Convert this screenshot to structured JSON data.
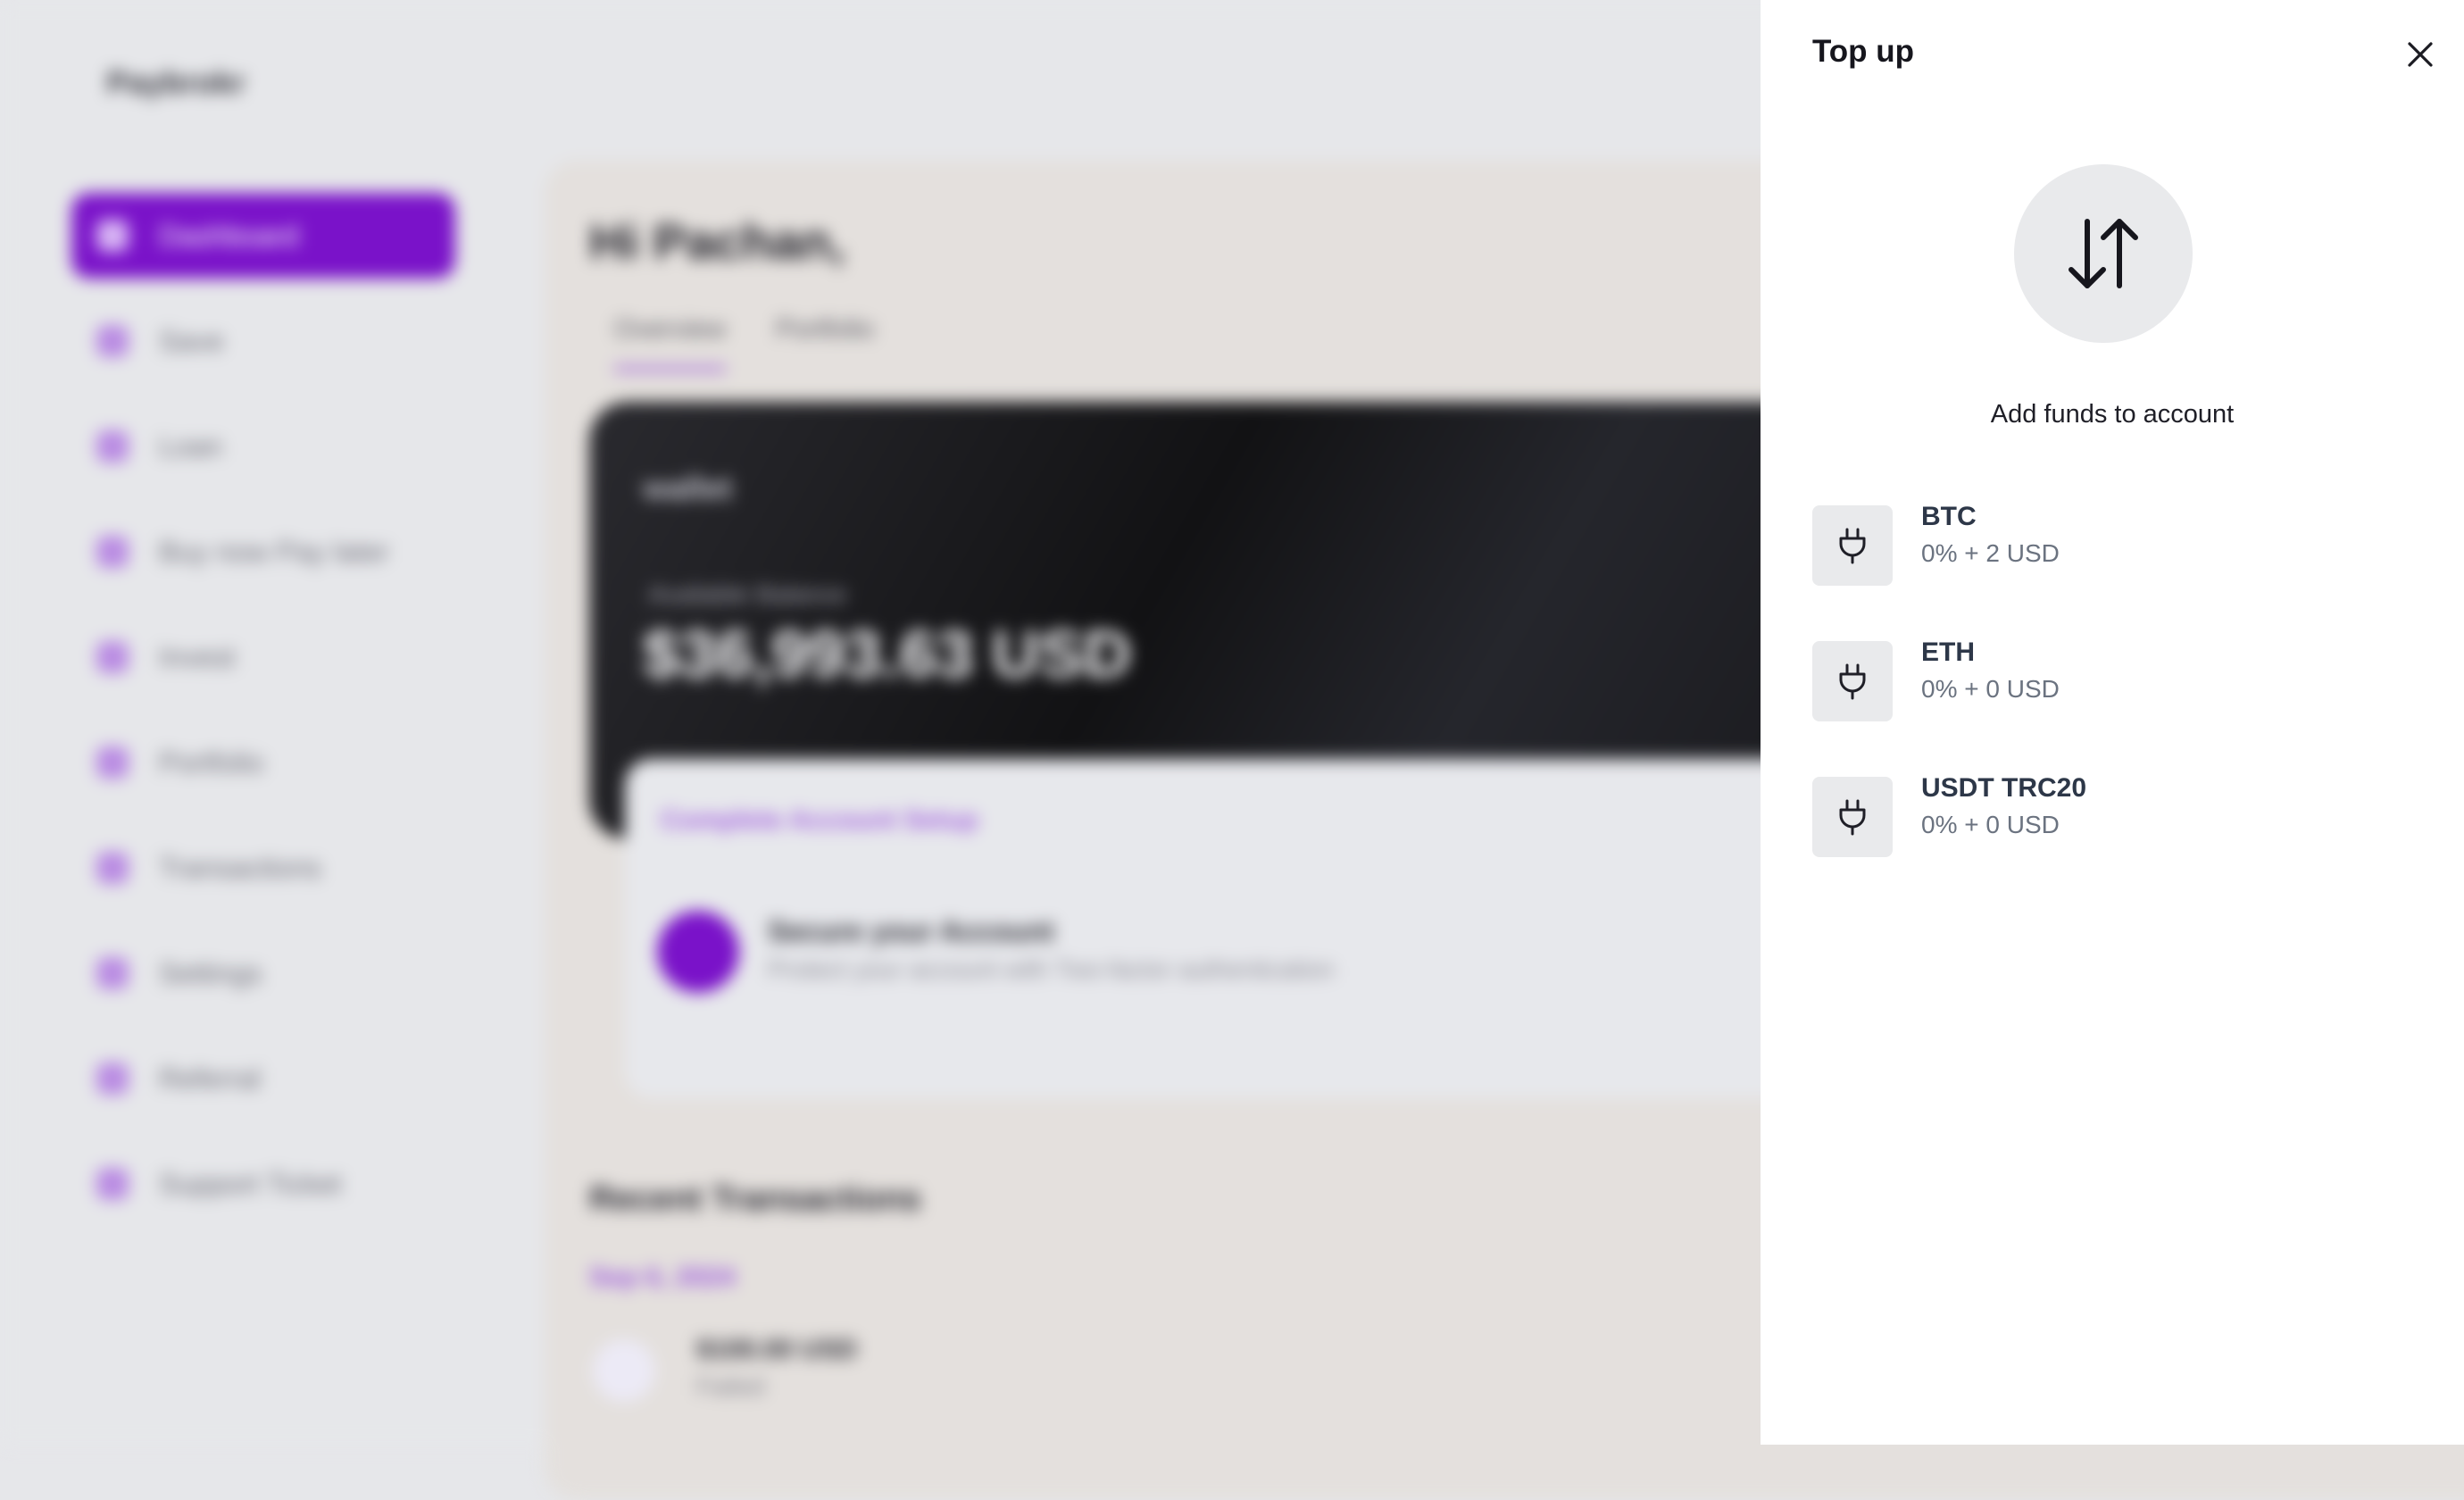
{
  "background": {
    "logo": "Paybrokr",
    "nav": [
      {
        "label": "Dashboard",
        "active": true
      },
      {
        "label": "Save"
      },
      {
        "label": "Loan"
      },
      {
        "label": "Buy now Pay later"
      },
      {
        "label": "Invest"
      },
      {
        "label": "Portfolio"
      },
      {
        "label": "Transactions"
      },
      {
        "label": "Settings"
      },
      {
        "label": "Referral"
      },
      {
        "label": "Support Ticket"
      }
    ],
    "greeting": "Hi Pachan,",
    "tabs": [
      "Overview",
      "Portfolio"
    ],
    "card": {
      "wallet_label": "wallet",
      "available_label": "Available Balance",
      "balance": "$36,993.63 USD"
    },
    "setup": {
      "title": "Complete Account Setup",
      "item_title": "Secure your Account",
      "item_subtitle": "Protect your account with Two-factor authentication"
    },
    "recent": {
      "title": "Recent Transactions",
      "date": "Sep 6, 2024",
      "tx_amount": "$100.00 USD",
      "tx_status": "Failed"
    }
  },
  "drawer": {
    "title": "Top up",
    "subtitle": "Add funds to account",
    "hero_icon": "swap-vertical-icon",
    "methods": [
      {
        "name": "BTC",
        "fee": "0% + 2 USD",
        "icon": "plug-icon"
      },
      {
        "name": "ETH",
        "fee": "0% + 0 USD",
        "icon": "plug-icon"
      },
      {
        "name": "USDT TRC20",
        "fee": "0% + 0 USD",
        "icon": "plug-icon"
      }
    ]
  },
  "colors": {
    "accent": "#7a12c9",
    "drawer_bg": "#ffffff",
    "icon_tile": "#e9eaec"
  }
}
